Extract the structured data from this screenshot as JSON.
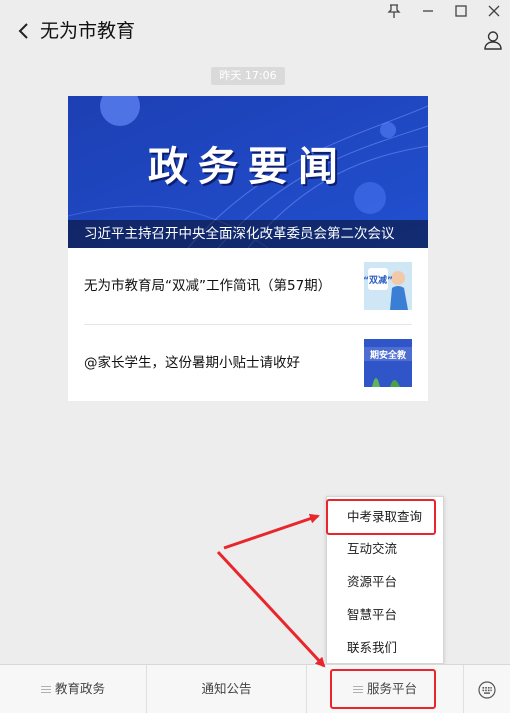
{
  "header": {
    "account_name": "无为市教育",
    "back_icon": "chevron-left-icon",
    "window_controls": [
      "pin-icon",
      "minimize-icon",
      "maximize-icon",
      "close-icon"
    ],
    "profile_icon": "person-icon"
  },
  "timestamp": "昨天  17:06",
  "article_card": {
    "hero_text": "政务要闻",
    "hero_caption": "习近平主持召开中央全面深化改革委员会第二次会议",
    "items": [
      {
        "title": "无为市教育局“双减”工作简讯（第57期）",
        "thumb_text": "“双减”"
      },
      {
        "title": "@家长学生，这份暑期小贴士请收好",
        "thumb_text": "期安全教"
      }
    ]
  },
  "submenu": {
    "items": [
      "中考录取查询",
      "互动交流",
      "资源平台",
      "智慧平台",
      "联系我们"
    ]
  },
  "bottom_menu": {
    "tabs": [
      "教育政务",
      "通知公告",
      "服务平台"
    ],
    "keyboard_icon": "keyboard-icon"
  },
  "colors": {
    "highlight": "#e8262b",
    "hero_blue": "#1a3aa8"
  }
}
